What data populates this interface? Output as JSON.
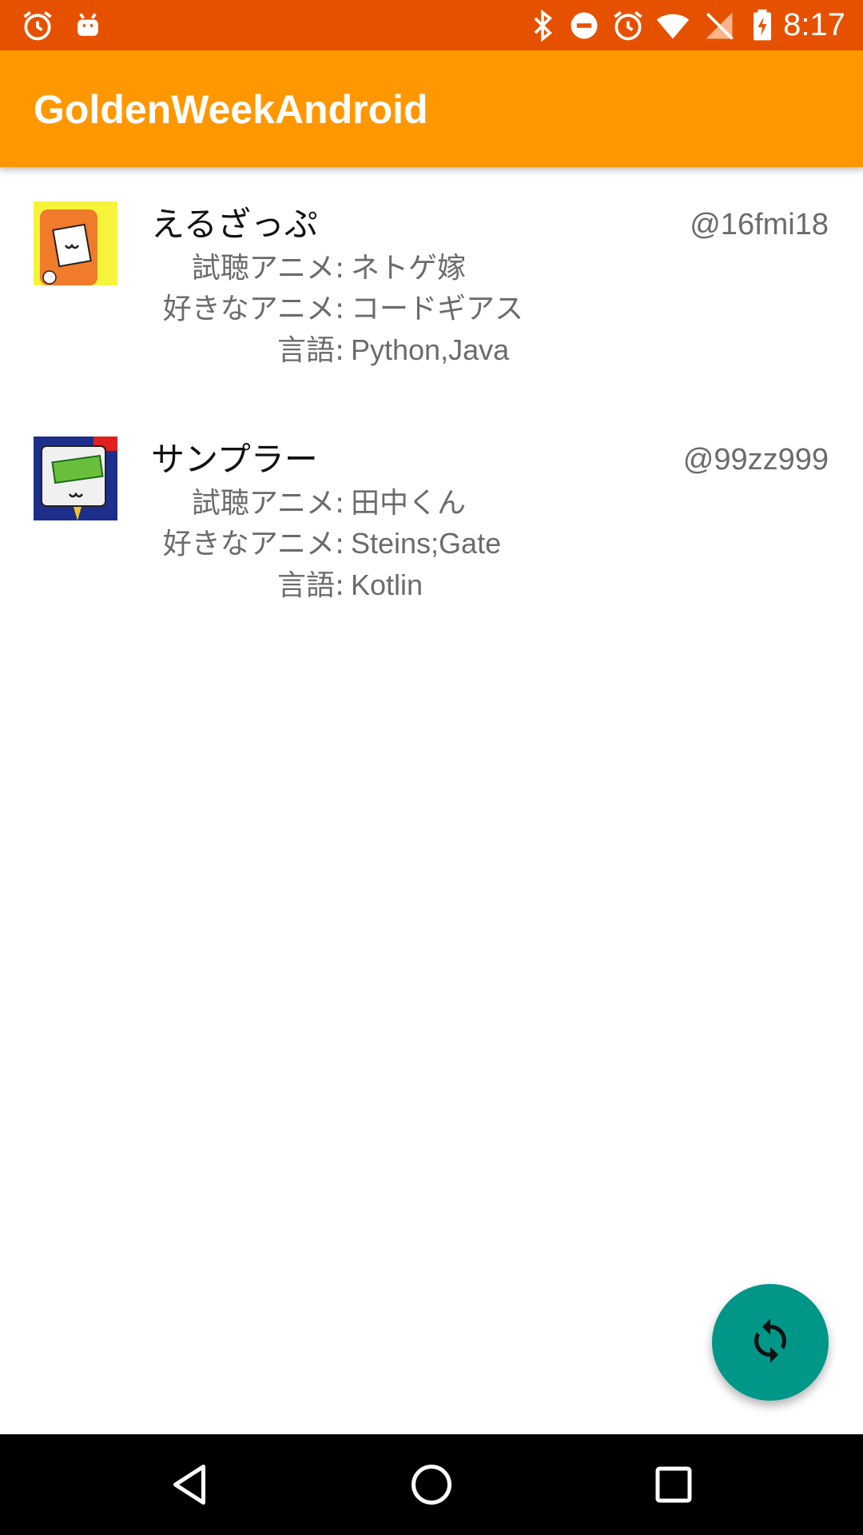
{
  "status_bar": {
    "time": "8:17",
    "left_icons": [
      "alarm-icon",
      "android-debug-icon"
    ],
    "right_icons": [
      "bluetooth-icon",
      "do-not-disturb-icon",
      "alarm-icon",
      "wifi-icon",
      "no-signal-icon",
      "battery-charging-icon"
    ],
    "background_color": "#e65100"
  },
  "app_bar": {
    "title": "GoldenWeekAndroid",
    "background_color": "#ff9800"
  },
  "users": [
    {
      "name": "えるざっぷ",
      "handle": "@16fmi18",
      "watching_label": "試聴アニメ",
      "watching": "ネトゲ嫁",
      "favorite_label": "好きなアニメ",
      "favorite": "コードギアス",
      "language_label": "言語",
      "language": "Python,Java"
    },
    {
      "name": "サンプラー",
      "handle": "@99zz999",
      "watching_label": "試聴アニメ",
      "watching": "田中くん",
      "favorite_label": "好きなアニメ",
      "favorite": "Steins;Gate",
      "language_label": "言語",
      "language": "Kotlin"
    }
  ],
  "fab": {
    "icon": "refresh-icon",
    "background_color": "#009688"
  },
  "nav_bar": {
    "icons": [
      "back-icon",
      "home-icon",
      "recents-icon"
    ]
  }
}
